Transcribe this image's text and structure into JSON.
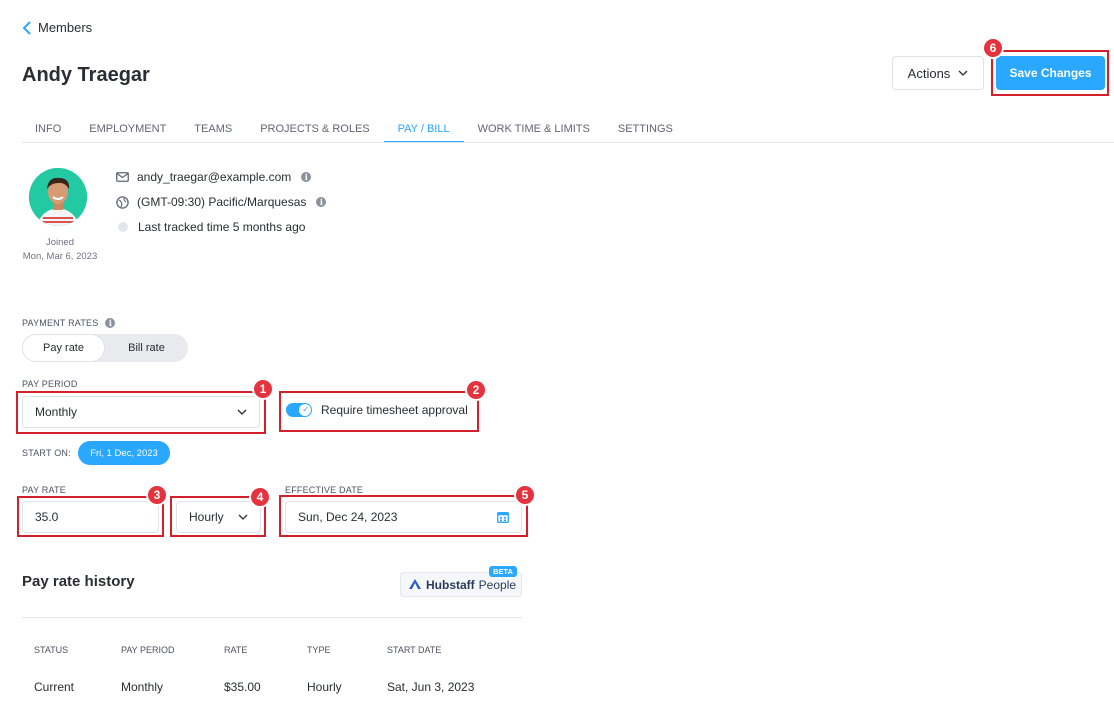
{
  "back": {
    "label": "Members"
  },
  "page_title": "Andy Traegar",
  "header": {
    "actions_label": "Actions",
    "save_label": "Save Changes"
  },
  "tabs": [
    {
      "label": "INFO"
    },
    {
      "label": "EMPLOYMENT"
    },
    {
      "label": "TEAMS"
    },
    {
      "label": "PROJECTS & ROLES"
    },
    {
      "label": "PAY / BILL",
      "active": true
    },
    {
      "label": "WORK TIME & LIMITS"
    },
    {
      "label": "SETTINGS"
    }
  ],
  "profile": {
    "joined_label": "Joined",
    "joined_date": "Mon, Mar 6, 2023",
    "email": "andy_traegar@example.com",
    "timezone": "(GMT-09:30) Pacific/Marquesas",
    "last_tracked": "Last tracked time 5 months ago"
  },
  "payment_rates": {
    "label": "PAYMENT RATES",
    "segments": [
      "Pay rate",
      "Bill rate"
    ],
    "active_segment": "Pay rate"
  },
  "pay_period": {
    "label": "PAY PERIOD",
    "value": "Monthly"
  },
  "timesheet": {
    "label": "Require timesheet approval",
    "enabled": true
  },
  "start_on": {
    "label": "START ON:",
    "value": "Fri, 1 Dec, 2023"
  },
  "pay_rate": {
    "label": "PAY RATE",
    "value": "35.0",
    "type": "Hourly"
  },
  "effective_date": {
    "label": "EFFECTIVE DATE",
    "value": "Sun, Dec 24, 2023"
  },
  "annotations": [
    "1",
    "2",
    "3",
    "4",
    "5",
    "6"
  ],
  "history": {
    "title": "Pay rate history",
    "brand": {
      "name": "Hubstaff",
      "product": "People",
      "badge": "BETA"
    },
    "columns": [
      "STATUS",
      "PAY PERIOD",
      "RATE",
      "TYPE",
      "START DATE"
    ],
    "rows": [
      {
        "status": "Current",
        "pay_period": "Monthly",
        "rate": "$35.00",
        "type": "Hourly",
        "start_date": "Sat, Jun 3, 2023"
      }
    ]
  },
  "colors": {
    "accent": "#2aa7ff",
    "highlight": "#d3202d",
    "avatar_bg": "#22c9a3"
  }
}
